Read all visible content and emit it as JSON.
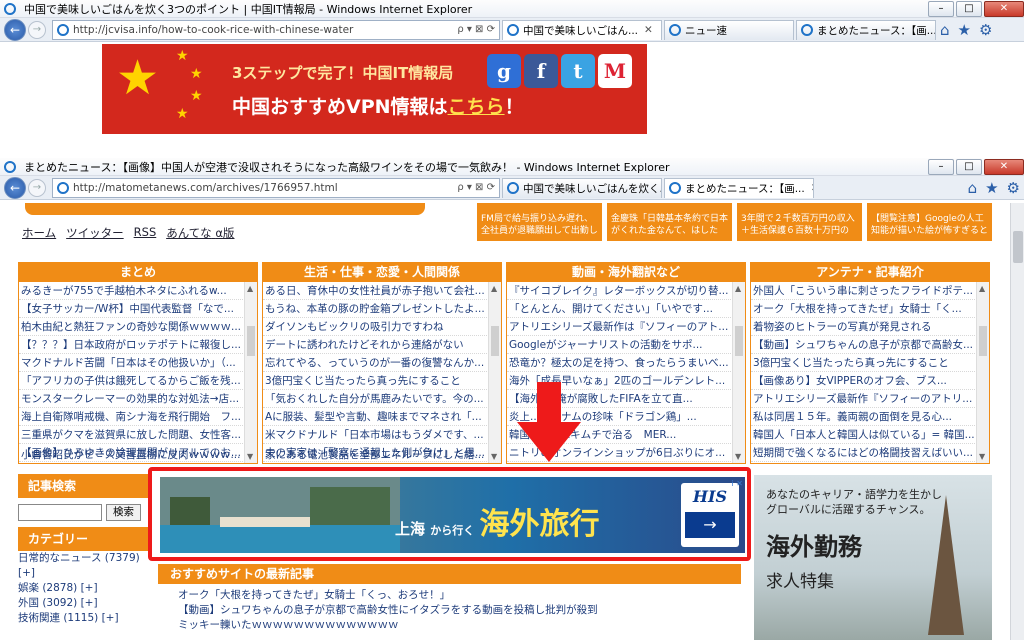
{
  "window1": {
    "title": "中国で美味しいごはんを炊く3つのポイント | 中国IT情報局 - Windows Internet Explorer",
    "url": "http://jcvisa.info/how-to-cook-rice-with-chinese-water",
    "addr_controls": "ρ ▾ ⊠ ⟳",
    "tabs": [
      "中国で美味しいごはん...",
      "ニュー速",
      "まとめたニュース：【画..."
    ],
    "banner": {
      "line1": "3ステップで完了！中国IT情報局",
      "line2": "中国おすすめVPN情報は",
      "link": "こちら",
      "after": "！"
    }
  },
  "window2": {
    "title": "まとめたニュース：【画像】中国人が空港で没収されそうになった高級ワインをその場で一気飲み！ - Windows Internet Explorer",
    "url": "http://matometanews.com/archives/1766957.html",
    "addr_controls": "ρ ▾ ⊠ ⟳",
    "tabs": [
      "中国で美味しいごはんを炊く...",
      "まとめたニュース：【画..."
    ],
    "nav": [
      "ホーム",
      "ツイッター",
      "RSS",
      "あんてな",
      "α版"
    ],
    "thumbs": [
      "FM局で給与振り込み遅れ、全社員が退職願出して出勤し",
      "金慶珠「日韓基本条約で日本がくれた金なんて、はした",
      "3年間で２千数百万円の収入＋生活保護６百数十万円の",
      "【閲覧注意】Googleの人工知能が描いた絵が怖すぎると"
    ],
    "columns": [
      {
        "title": "まとめ",
        "items": [
          "みるきーが755で手越柏木ネタにふれるw...",
          "【女子サッカー/W杯】中国代表監督「なで...",
          "柏木由紀と熱狂ファンの奇妙な関係ｗｗｗｗ...",
          "【？？？】日本政府がロッテポテトに報復し...",
          "マクドナルド苦闘「日本はその他扱いか」（...",
          "「アフリカの子供は餓死してるからご飯を残...",
          "モンスタークレーマーの効果的な対処法→店...",
          "海上自衛隊哨戒機、南シナ海を飛行開始　フ...",
          "三重県がクマを滋賀県に放した問題、女性客...",
          "【画像】ひろゆきの論理展開がリアルでのお..."
        ],
        "last": "小倉智昭氏がピース又吉直樹に皮肉ｗｗｗｗ..."
      },
      {
        "title": "生活・仕事・恋愛・人間関係",
        "items": [
          "ある日、育休中の女性社員が赤子抱いて会社...",
          "もうね、本革の豚の貯金箱プレゼントしたよ...",
          "ダイソンもビックリの吸引力ですわね",
          "デートに誘われたけどそれから連絡がない",
          "忘れてやる、っていうのが一番の復讐なんか...",
          "3億円宝くじ当たったら真っ先にすること",
          "「気おくれした自分が馬鹿みたいです。今の...",
          "Aに服装、髪型や言動、趣味までマネされ「...",
          "米マクドナルド「日本市場はもうダメです、...",
          "夫の実家は「警察に通報した側が負け」と思..."
        ],
        "last": "家にある電池製品を全部エネループにした結..."
      },
      {
        "title": "動画・海外翻訳など",
        "items": [
          "『サイコブレイク』レターボックスが切り替...",
          "「とんとん、開けてください」「いやです...",
          "アトリエシリーズ最新作は『ソフィーのアト...",
          "Googleがジャーナリストの活動をサポ...",
          "恐竜か？極太の足を持つ、食ったらうまいべ...",
          "海外「成長早いなぁ」2匹のゴールデンレト...",
          "【海外】「俺が腐敗したFIFAを立て直...",
          "炎上...ベトナムの珍味「ドラゴン鶏」...",
          "韓国MERSはキムチで治る　MER...",
          "ニトリのオンラインショップが6日ぶりにオ..."
        ],
        "last": ""
      },
      {
        "title": "アンテナ・記事紹介",
        "items": [
          "外国人「こういう串に刺さったフライドポテ...",
          "オーク「大根を持ってきたぜ」女騎士「く...",
          "着物姿のヒトラーの写真が発見される",
          "【動画】シュワちゃんの息子が京都で高齢女...",
          "3億円宝くじ当たったら真っ先にすること",
          "【画像あり】女VIPPERのオフ会、ブス...",
          "アトリエシリーズ最新作『ソフィーのアトリ...",
          "私は同居１５年。義両親の面倒を見る心...",
          "韓国人「日本人と韓国人は似ている」= 韓国...",
          "短期間で強くなるにはどの格闘技習えばいい..."
        ],
        "last": ""
      }
    ],
    "sidebar": {
      "search_title": "記事検索",
      "search_btn": "検索",
      "cat_title": "カテゴリー",
      "cats": [
        "日常的なニュース (7379) [+]",
        "娯楽 (2878) [+]",
        "外国 (3092) [+]",
        "技術関連 (1115) [+]"
      ]
    },
    "ad": {
      "city": "上海",
      "from": "から行く",
      "main": "海外旅行",
      "brand": "HIS",
      "arrow": "→",
      "x": "i ✕"
    },
    "recommend": {
      "title": "おすすめサイトの最新記事",
      "items": [
        "オーク「大根を持ってきたぜ」女騎士「くっ、おろせ！」",
        "【動画】シュワちゃんの息子が京都で高齢女性にイタズラをする動画を投稿し批判が殺到",
        "ミッキー轢いたｗｗｗｗｗｗｗｗｗｗｗｗｗｗ"
      ]
    },
    "right_ad": {
      "line1": "あなたのキャリア・語学力を生かし",
      "line2": "グローバルに活躍するチャンス。",
      "big": "海外勤務",
      "sub": "求人特集"
    }
  }
}
